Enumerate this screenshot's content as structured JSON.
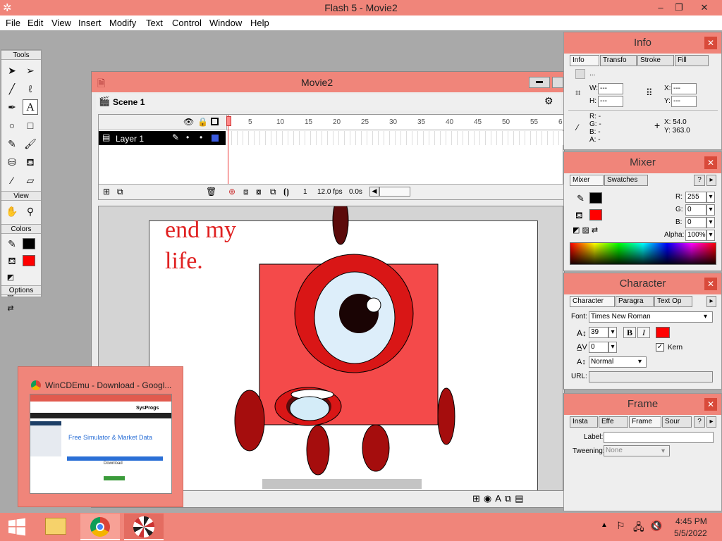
{
  "app": {
    "title": "Flash 5 - Movie2",
    "minimize": "–",
    "maximize": "❐",
    "close": "✕"
  },
  "menu": [
    "File",
    "Edit",
    "View",
    "Insert",
    "Modify",
    "Text",
    "Control",
    "Window",
    "Help"
  ],
  "tools": {
    "title": "Tools",
    "view": "View",
    "colors": "Colors",
    "options": "Options"
  },
  "movie": {
    "title": "Movie2",
    "scene": "Scene 1",
    "layer": "Layer 1",
    "frame_numbers": [
      "5",
      "10",
      "15",
      "20",
      "25",
      "30",
      "35",
      "40",
      "45",
      "50",
      "55",
      "6"
    ],
    "current_frame": "1",
    "fps": "12.0 fps",
    "time": "0.0s",
    "stage_text": "end my life."
  },
  "info": {
    "title": "Info",
    "tabs": [
      "Info",
      "Transfo",
      "Stroke",
      "Fill"
    ],
    "w_label": "W:",
    "h_label": "H:",
    "x_label": "X:",
    "y_label": "Y:",
    "w": "---",
    "h": "---",
    "x": "---",
    "y": "---",
    "rgb": [
      "R: -",
      "G: -",
      "B: -",
      "A: -"
    ],
    "cursor_x": "X:  54.0",
    "cursor_y": "Y:  363.0",
    "dots": "..."
  },
  "mixer": {
    "title": "Mixer",
    "tabs": [
      "Mixer",
      "Swatches"
    ],
    "r_label": "R:",
    "g_label": "G:",
    "b_label": "B:",
    "alpha_label": "Alpha:",
    "r": "255",
    "g": "0",
    "b": "0",
    "alpha": "100%"
  },
  "character": {
    "title": "Character",
    "tabs": [
      "Character",
      "Paragra",
      "Text Op"
    ],
    "font_label": "Font:",
    "font": "Times New Roman",
    "size": "39",
    "bold": "B",
    "italic": "I",
    "tracking": "0",
    "kern_label": "Kern",
    "baseline": "Normal",
    "url_label": "URL:"
  },
  "frame": {
    "title": "Frame",
    "tabs": [
      "Insta",
      "Effe",
      "Frame",
      "Sour"
    ],
    "label_label": "Label:",
    "tweening_label": "Tweening:",
    "tweening": "None"
  },
  "preview": {
    "title": "WinCDEmu - Download - Googl...",
    "brand": "SysProgs",
    "heading": "Free Simulator & Market Data",
    "download": "Download"
  },
  "clock": {
    "time": "4:45 PM",
    "date": "5/5/2022"
  },
  "colors": {
    "accent": "#f0857a",
    "stroke": "#000000",
    "fill": "#ff0000",
    "numberblock": "#f44a4a",
    "dark_red": "#a50d0d"
  }
}
